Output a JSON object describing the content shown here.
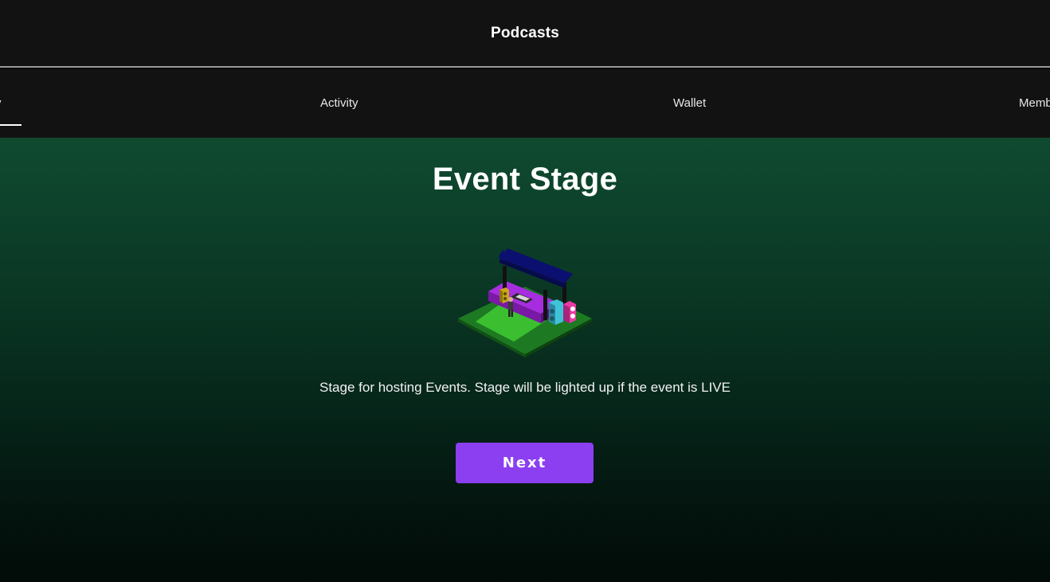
{
  "header": {
    "title": "Podcasts"
  },
  "tabs": [
    {
      "label": "y",
      "active": true
    },
    {
      "label": "Activity",
      "active": false
    },
    {
      "label": "Wallet",
      "active": false
    },
    {
      "label": "Memb",
      "active": false
    }
  ],
  "main": {
    "title": "Event Stage",
    "illustration_icon": "event-stage-illustration",
    "description": "Stage for hosting Events. Stage will be lighted up if the event is LIVE",
    "next_label": "Next"
  },
  "colors": {
    "topbar_bg": "#121212",
    "gradient_top": "#0f4a30",
    "gradient_bottom": "#020b08",
    "button_purple": "#8b3ff0"
  }
}
